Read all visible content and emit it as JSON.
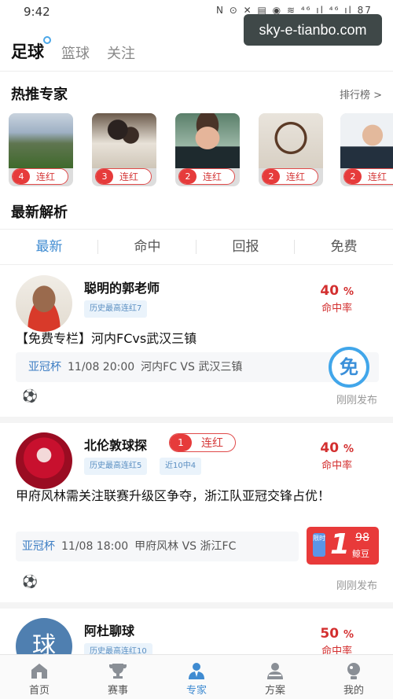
{
  "status_bar": {
    "time": "9:42",
    "icons_text": "N ⊙ ✕ ▤ ◉ ≋ ⁴⁶ ıl ⁴⁶ ıl 87",
    "watermark": "sky-e-tianbo.com"
  },
  "sport_tabs": [
    {
      "label": "足球",
      "active": true
    },
    {
      "label": "篮球",
      "active": false
    },
    {
      "label": "关注",
      "active": false
    }
  ],
  "hot_experts": {
    "title": "热推专家",
    "rank_link": "排行榜 >",
    "cards": [
      {
        "streak": "4",
        "streak_label": "连红",
        "photo": "stadium"
      },
      {
        "streak": "3",
        "streak_label": "连红",
        "photo": "people"
      },
      {
        "streak": "2",
        "streak_label": "连红",
        "photo": "player"
      },
      {
        "streak": "2",
        "streak_label": "连红",
        "photo": "shelf"
      },
      {
        "streak": "2",
        "streak_label": "连红",
        "photo": "man-suit"
      }
    ]
  },
  "latest": {
    "title": "最新解析",
    "filters": [
      {
        "label": "最新",
        "active": true
      },
      {
        "label": "命中",
        "active": false
      },
      {
        "label": "回报",
        "active": false
      },
      {
        "label": "免费",
        "active": false
      }
    ]
  },
  "feed": [
    {
      "name": "聪明的郭老师",
      "tags": [
        "历史最高连红7"
      ],
      "hit_pct": "40",
      "hit_unit": "%",
      "hit_label": "命中率",
      "title": "【免费专栏】河内FCvs武汉三镇",
      "match_cup": "亚冠杯",
      "match_time": "11/08 20:00",
      "match_teams": "河内FC VS 武汉三镇",
      "free_icon": "免",
      "published": "刚刚发布"
    },
    {
      "name": "北伦敦球探",
      "streak": "1",
      "streak_label": "连红",
      "tags": [
        "历史最高连红5",
        "近10中4"
      ],
      "hit_pct": "40",
      "hit_unit": "%",
      "hit_label": "命中率",
      "title": "甲府风林需关注联赛升级区争夺，浙江队亚冠交锋占优！",
      "match_cup": "亚冠杯",
      "match_time": "11/08 18:00",
      "match_teams": "甲府风林 VS 浙江FC",
      "price": "1",
      "price_old": "98",
      "price_unit": "鲸豆",
      "price_tag": "限时",
      "published": "刚刚发布"
    },
    {
      "name": "阿杜聊球",
      "avatar_text": "球",
      "tags": [
        "历史最高连红10"
      ],
      "hit_pct": "50",
      "hit_unit": "%",
      "hit_label": "命中率"
    }
  ],
  "bottom_nav": [
    {
      "label": "首页",
      "icon": "home-icon",
      "active": false
    },
    {
      "label": "赛事",
      "icon": "trophy-icon",
      "active": false
    },
    {
      "label": "专家",
      "icon": "expert-icon",
      "active": true
    },
    {
      "label": "方案",
      "icon": "plan-icon",
      "active": false
    },
    {
      "label": "我的",
      "icon": "profile-icon",
      "active": false
    }
  ],
  "colors": {
    "accent": "#3f8bd1",
    "red": "#e63b3b",
    "light_blue": "#eaf3fb"
  }
}
